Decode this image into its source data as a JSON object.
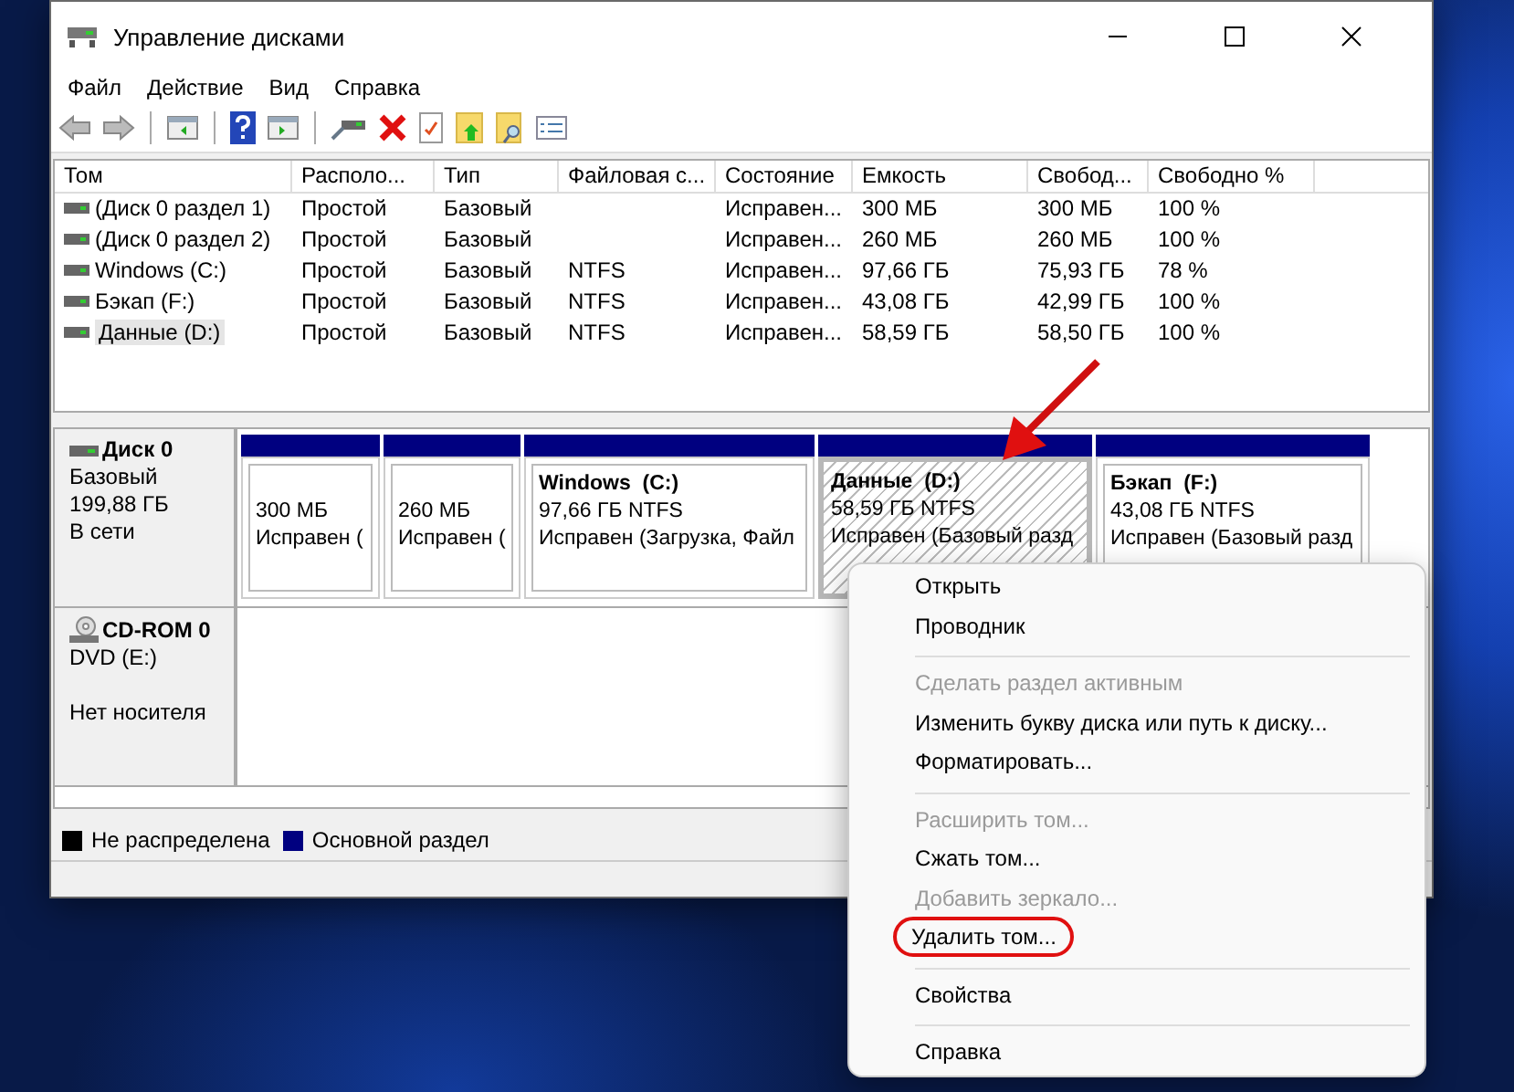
{
  "window": {
    "title": "Управление дисками"
  },
  "menu": [
    "Файл",
    "Действие",
    "Вид",
    "Справка"
  ],
  "table": {
    "columns": [
      "Том",
      "Располо...",
      "Тип",
      "Файловая с...",
      "Состояние",
      "Емкость",
      "Свобод...",
      "Свободно %"
    ],
    "rows": [
      {
        "cells": [
          "(Диск 0 раздел 1)",
          "Простой",
          "Базовый",
          "",
          "Исправен...",
          "300 МБ",
          "300 МБ",
          "100 %"
        ],
        "selected": false
      },
      {
        "cells": [
          "(Диск 0 раздел 2)",
          "Простой",
          "Базовый",
          "",
          "Исправен...",
          "260 МБ",
          "260 МБ",
          "100 %"
        ],
        "selected": false
      },
      {
        "cells": [
          "Windows (C:)",
          "Простой",
          "Базовый",
          "NTFS",
          "Исправен...",
          "97,66 ГБ",
          "75,93 ГБ",
          "78 %"
        ],
        "selected": false
      },
      {
        "cells": [
          "Бэкап (F:)",
          "Простой",
          "Базовый",
          "NTFS",
          "Исправен...",
          "43,08 ГБ",
          "42,99 ГБ",
          "100 %"
        ],
        "selected": false
      },
      {
        "cells": [
          "Данные (D:)",
          "Простой",
          "Базовый",
          "NTFS",
          "Исправен...",
          "58,59 ГБ",
          "58,50 ГБ",
          "100 %"
        ],
        "selected": true
      }
    ]
  },
  "disks": [
    {
      "kind": "disk",
      "name": "Диск 0",
      "type": "Базовый",
      "size": "199,88 ГБ",
      "status": "В сети",
      "partitions": [
        {
          "size": "300 МБ",
          "status": "Исправен (",
          "selected": false
        },
        {
          "size": "260 МБ",
          "status": "Исправен (",
          "selected": false
        },
        {
          "title": "Windows  (C:)",
          "size": "97,66 ГБ NTFS",
          "status": "Исправен (Загрузка, Файл",
          "selected": false
        },
        {
          "title": "Данные  (D:)",
          "size": "58,59 ГБ NTFS",
          "status": "Исправен (Базовый разд",
          "selected": true
        },
        {
          "title": "Бэкап  (F:)",
          "size": "43,08 ГБ NTFS",
          "status": "Исправен (Базовый разд",
          "selected": false
        }
      ]
    },
    {
      "kind": "cdrom",
      "name": "CD-ROM 0",
      "type": "DVD (E:)",
      "status": "Нет носителя"
    }
  ],
  "legend": [
    {
      "label": "Не распределена",
      "color": "#000000"
    },
    {
      "label": "Основной раздел",
      "color": "#000080"
    }
  ],
  "context_menu": [
    {
      "kind": "item",
      "label": "Открыть",
      "disabled": false,
      "circled": false
    },
    {
      "kind": "item",
      "label": "Проводник",
      "disabled": false,
      "circled": false
    },
    {
      "kind": "separator"
    },
    {
      "kind": "item",
      "label": "Сделать раздел активным",
      "disabled": true,
      "circled": false
    },
    {
      "kind": "item",
      "label": "Изменить букву диска или путь к диску...",
      "disabled": false,
      "circled": false
    },
    {
      "kind": "item",
      "label": "Форматировать...",
      "disabled": false,
      "circled": false
    },
    {
      "kind": "separator"
    },
    {
      "kind": "item",
      "label": "Расширить том...",
      "disabled": true,
      "circled": false
    },
    {
      "kind": "item",
      "label": "Сжать том...",
      "disabled": false,
      "circled": false
    },
    {
      "kind": "item",
      "label": "Добавить зеркало...",
      "disabled": true,
      "circled": false
    },
    {
      "kind": "item",
      "label": "Удалить том...",
      "disabled": false,
      "circled": true
    },
    {
      "kind": "separator"
    },
    {
      "kind": "item",
      "label": "Свойства",
      "disabled": false,
      "circled": false
    },
    {
      "kind": "separator"
    },
    {
      "kind": "item",
      "label": "Справка",
      "disabled": false,
      "circled": false
    }
  ]
}
